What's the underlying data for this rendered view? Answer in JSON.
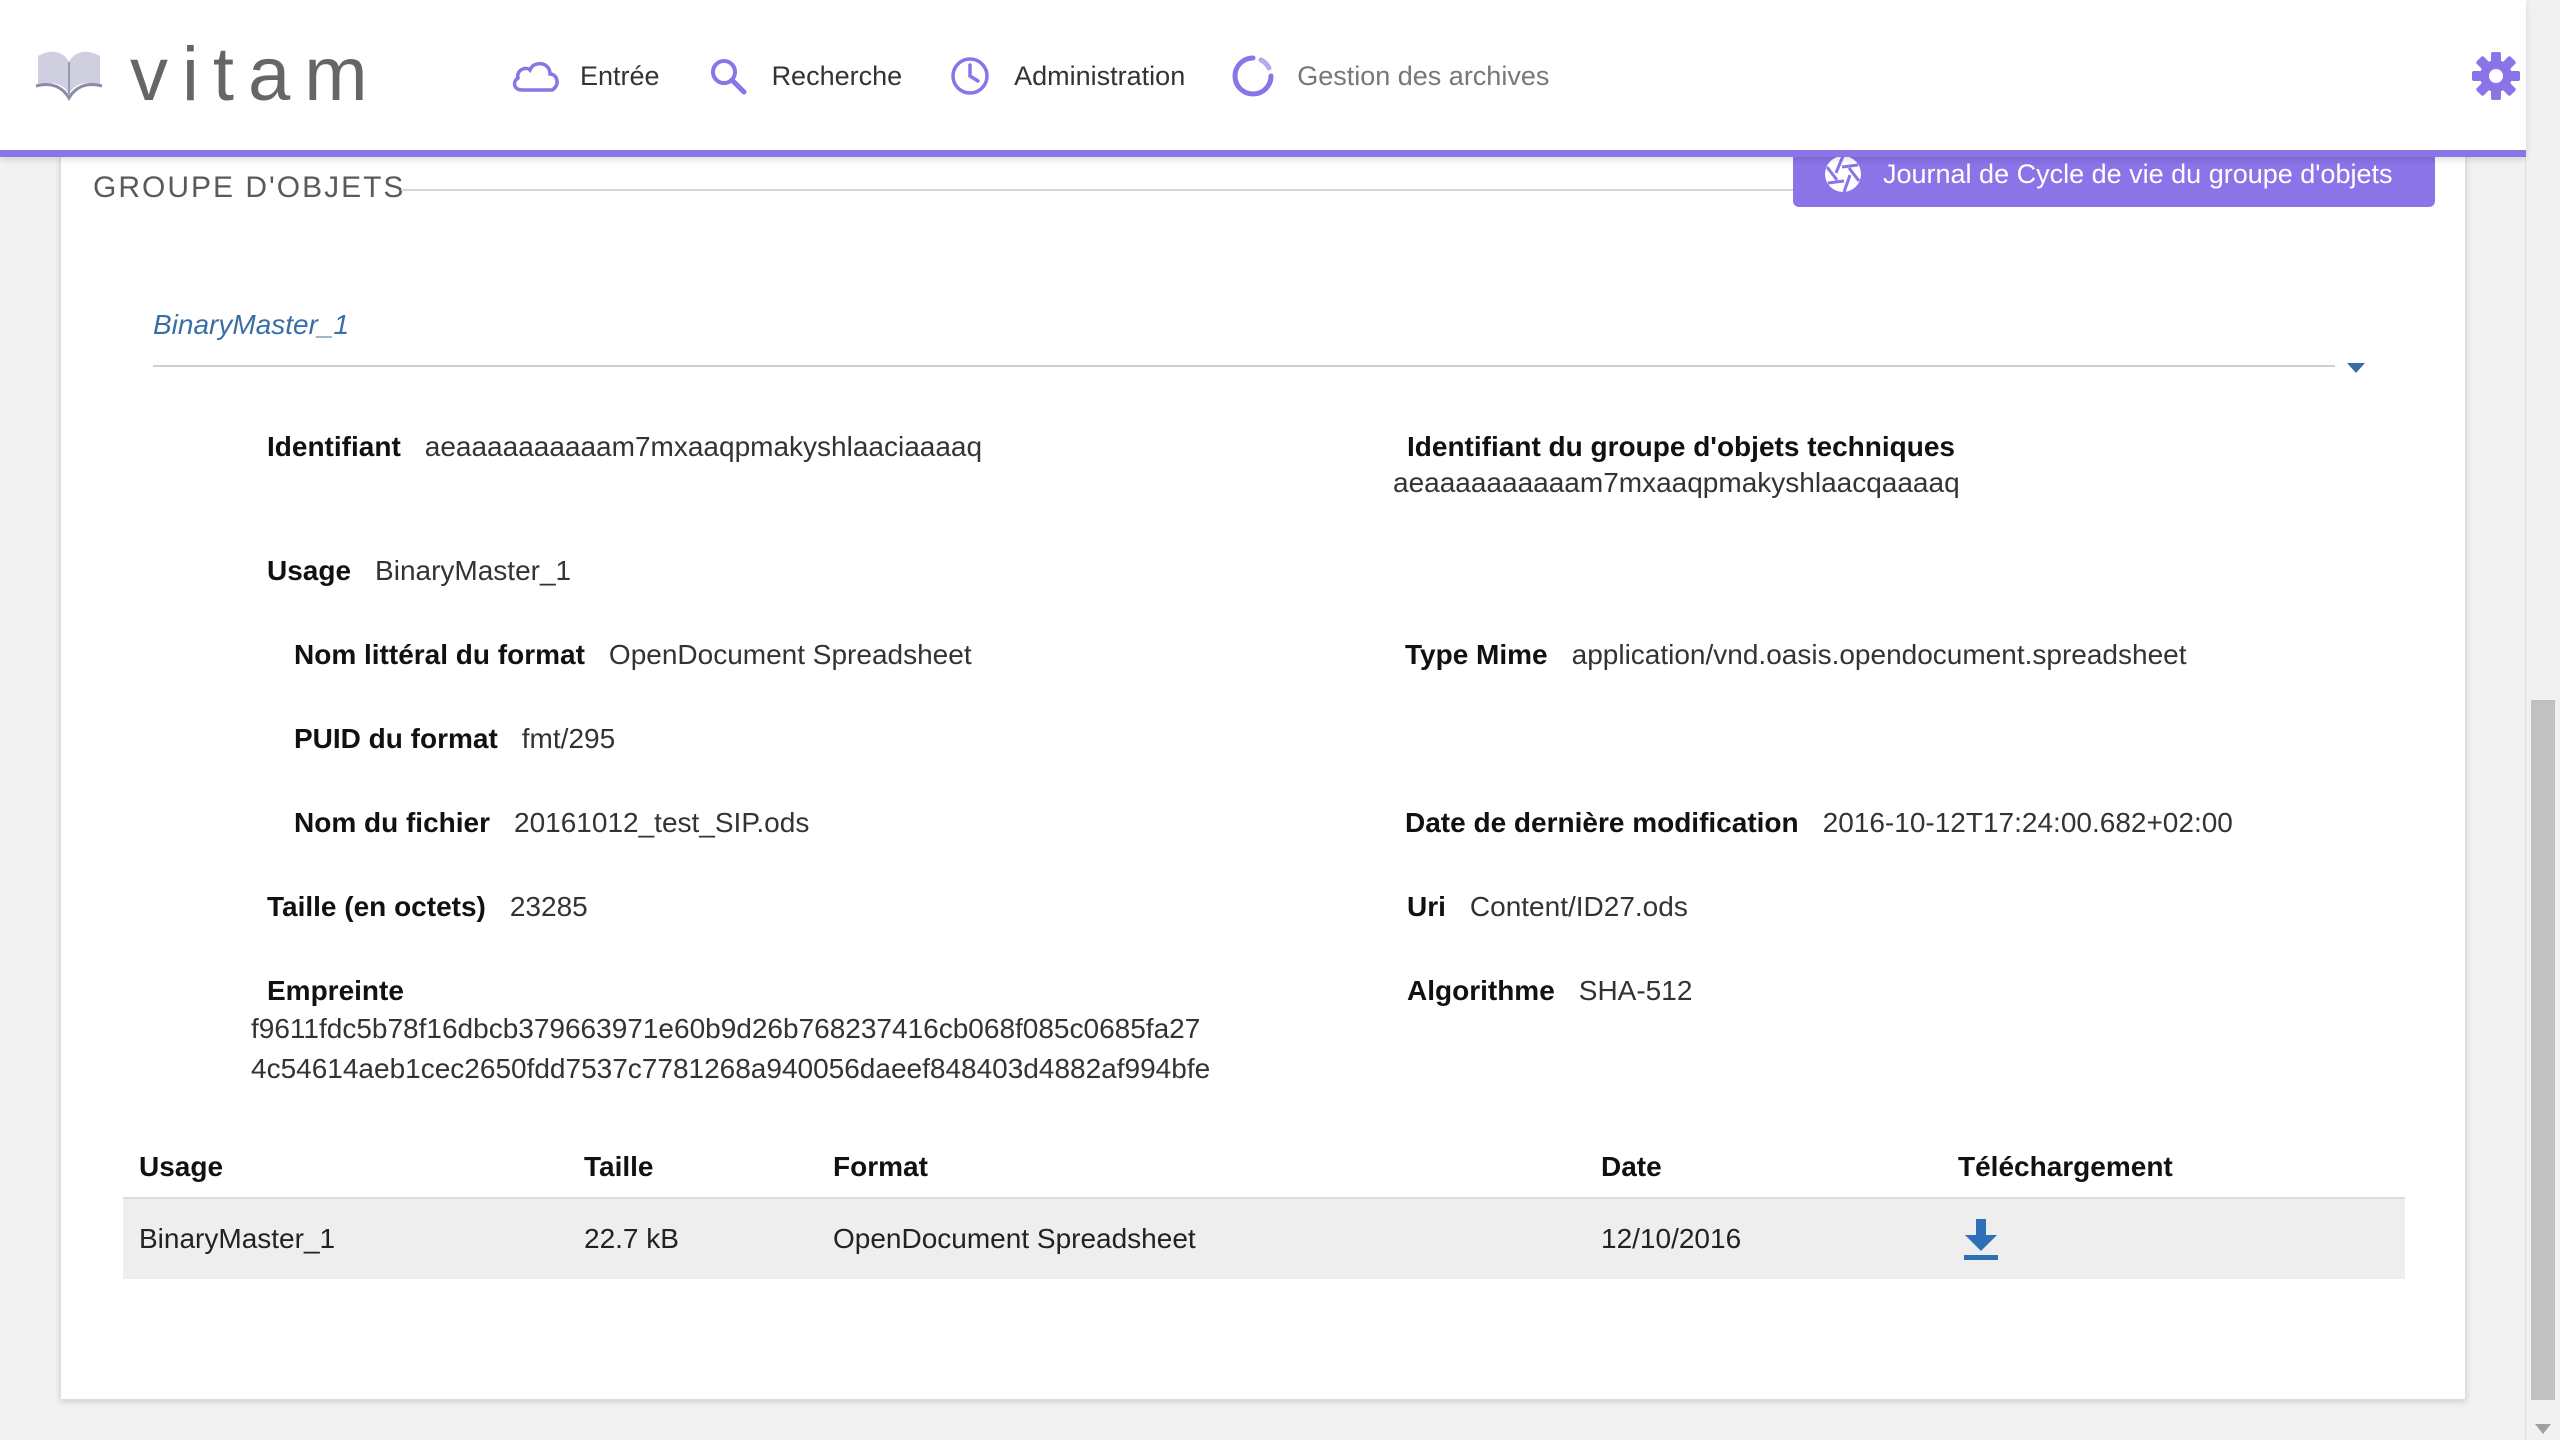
{
  "app": {
    "logo_text": "vitam"
  },
  "nav": {
    "items": [
      {
        "label": "Entrée",
        "icon": "cloud-icon"
      },
      {
        "label": "Recherche",
        "icon": "search-icon"
      },
      {
        "label": "Administration",
        "icon": "clock-icon"
      },
      {
        "label": "Gestion des archives",
        "icon": "loading-circle-icon"
      }
    ],
    "settings_icon": "gear-icon"
  },
  "colors": {
    "accent": "#8b73e8",
    "link": "#3b6ea5",
    "download": "#2f6fb7"
  },
  "section": {
    "title": "GROUPE D'OBJETS",
    "journal_button": "Journal de Cycle de vie du groupe d'objets",
    "binary_header": "BinaryMaster_1"
  },
  "details": {
    "identifiant": {
      "label": "Identifiant",
      "value": "aeaaaaaaaaaam7mxaaqpmakyshlaaciaaaaq"
    },
    "groupe_technique": {
      "label": "Identifiant du groupe d'objets techniques",
      "value": "aeaaaaaaaaaam7mxaaqpmakyshlaacqaaaaq"
    },
    "usage": {
      "label": "Usage",
      "value": "BinaryMaster_1"
    },
    "nom_format": {
      "label": "Nom littéral du format",
      "value": "OpenDocument Spreadsheet"
    },
    "type_mime": {
      "label": "Type Mime",
      "value": "application/vnd.oasis.opendocument.spreadsheet"
    },
    "puid": {
      "label": "PUID du format",
      "value": "fmt/295"
    },
    "nom_fichier": {
      "label": "Nom du fichier",
      "value": "20161012_test_SIP.ods"
    },
    "date_modif": {
      "label": "Date de dernière modification",
      "value": "2016-10-12T17:24:00.682+02:00"
    },
    "taille": {
      "label": "Taille (en octets)",
      "value": "23285"
    },
    "uri": {
      "label": "Uri",
      "value": "Content/ID27.ods"
    },
    "empreinte": {
      "label": "Empreinte",
      "value_line1": "f9611fdc5b78f16dbcb379663971e60b9d26b768237416cb068f085c0685fa27",
      "value_line2": "4c54614aeb1cec2650fdd7537c7781268a940056daeef848403d4882af994bfe"
    },
    "algorithme": {
      "label": "Algorithme",
      "value": "SHA-512"
    }
  },
  "table": {
    "headers": [
      "Usage",
      "Taille",
      "Format",
      "Date",
      "Téléchargement"
    ],
    "rows": [
      {
        "usage": "BinaryMaster_1",
        "taille": "22.7 kB",
        "format": "OpenDocument Spreadsheet",
        "date": "12/10/2016",
        "download_icon": "download-icon"
      }
    ]
  }
}
